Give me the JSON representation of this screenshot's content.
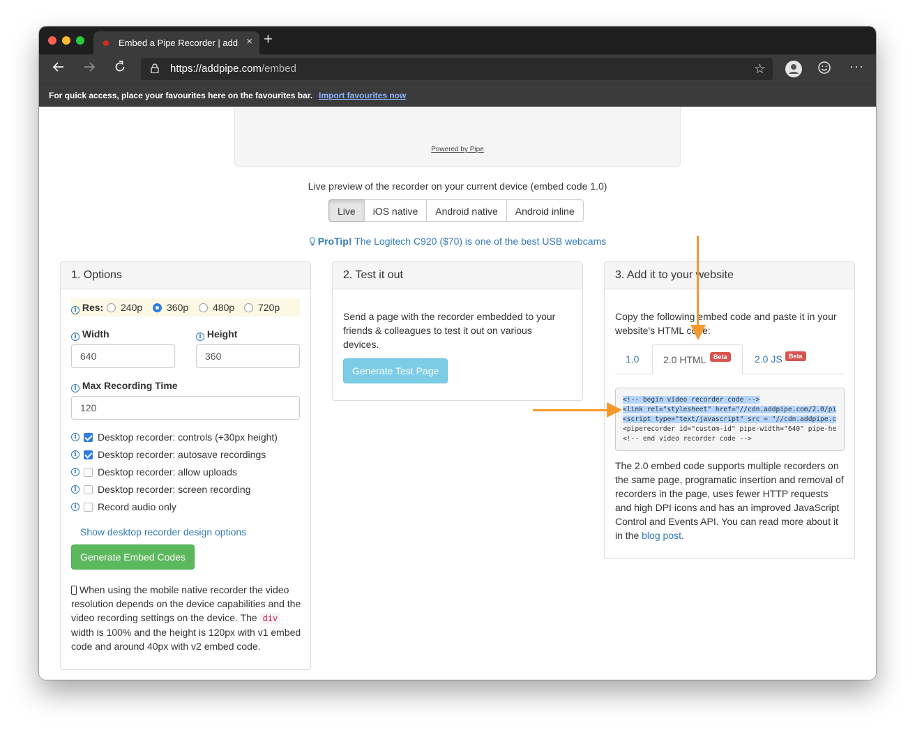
{
  "browser": {
    "tab_title": "Embed a Pipe Recorder | addpipe",
    "new_tab": "+",
    "close_tab": "×",
    "url_host": "https://addpipe.com",
    "url_path": "/embed",
    "favourites_text": "For quick access, place your favourites here on the favourites bar.",
    "favourites_link": "Import favourites now"
  },
  "preview": {
    "powered_by": "Powered by Pipe",
    "caption": "Live preview of the recorder on your current device (embed code 1.0)",
    "modes": [
      "Live",
      "iOS native",
      "Android native",
      "Android inline"
    ],
    "active_mode": "Live",
    "protip_label": "ProTip!",
    "protip_text": "The Logitech C920 ($70) is one of the best USB webcams"
  },
  "options": {
    "title": "1. Options",
    "res_label": "Res:",
    "resolutions": [
      "240p",
      "360p",
      "480p",
      "720p"
    ],
    "selected_resolution": "360p",
    "width_label": "Width",
    "width_value": "640",
    "height_label": "Height",
    "height_value": "360",
    "max_time_label": "Max Recording Time",
    "max_time_value": "120",
    "checkboxes": [
      {
        "label": "Desktop recorder: controls (+30px height)",
        "checked": true
      },
      {
        "label": "Desktop recorder: autosave recordings",
        "checked": true
      },
      {
        "label": "Desktop recorder: allow uploads",
        "checked": false
      },
      {
        "label": "Desktop recorder: screen recording",
        "checked": false
      },
      {
        "label": "Record audio only",
        "checked": false
      }
    ],
    "design_link": "Show desktop recorder design options",
    "generate_button": "Generate Embed Codes",
    "mobile_note_1": "When using the mobile native recorder the video resolution depends on the device capabilities and the video recording settings on the device. The ",
    "mobile_note_code": "div",
    "mobile_note_2": " width is 100% and the height is 120px with v1 embed code and around 40px with v2 embed code."
  },
  "test": {
    "title": "2. Test it out",
    "text": "Send a page with the recorder embedded to your friends & colleagues to test it out on various devices.",
    "button": "Generate Test Page"
  },
  "embed": {
    "title": "3. Add it to your website",
    "text": "Copy the following embed code and paste it in your website's HTML code:",
    "tabs": [
      {
        "label": "1.0",
        "beta": ""
      },
      {
        "label": "2.0 HTML",
        "beta": "Beta"
      },
      {
        "label": "2.0 JS",
        "beta": "Beta"
      }
    ],
    "active_tab": "2.0 HTML",
    "code_lines": [
      "<!-- begin video recorder code -->",
      "<link rel=\"stylesheet\" href=\"//cdn.addpipe.com/2.0/pi",
      "<script type=\"text/javascript\" src = \"//cdn.addpipe.c",
      "<piperecorder id=\"custom-id\" pipe-width=\"640\" pipe-he",
      "<!-- end video recorder code -->"
    ],
    "desc": "The 2.0 embed code supports multiple recorders on the same page, programatic insertion and removal of recorders in the page, uses fewer HTTP requests and high DPI icons and has an improved JavaScript Control and Events API. You can read more about it in the ",
    "desc_link": "blog post",
    "desc_end": "."
  },
  "colors": {
    "annotation_arrow": "#f39a2a",
    "link": "#337ab7",
    "green_button": "#5cb85c",
    "blue_button": "#5bc0de",
    "beta_badge": "#d9534f"
  }
}
